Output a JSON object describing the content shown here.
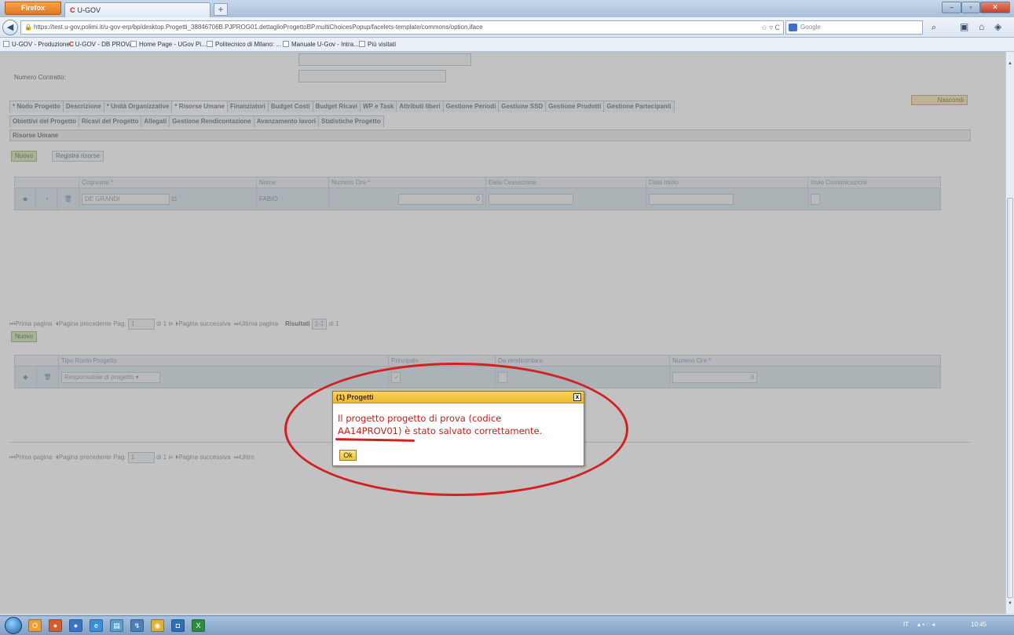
{
  "browser": {
    "menu_button": "Firefox",
    "tab_title": "U-GOV",
    "new_tab": "+",
    "url": "https://test.u-gov.polimi.it/u-gov-erp/bp/desktop.Progetti_38846706B.PJPROG01.dettaglioProgettoBP.multiChoicesPopup/facelets-template/commons/option.iface",
    "search_placeholder": "Google",
    "bookmarks": [
      "U-GOV - Produzione",
      "U-GOV - DB PROVA",
      "Home Page - UGov Pi...",
      "Politecnico di Milano: ...",
      "Manuale U-Gov - Intra...",
      "Più visitati"
    ]
  },
  "page": {
    "contract_label": "Numero Contratto:",
    "hide_button": "Nascondi",
    "tabs_row1": [
      {
        "label": "* Nodo Progetto",
        "active": false
      },
      {
        "label": "Descrizione",
        "active": false
      },
      {
        "label": "* Unità Organizzative",
        "active": false
      },
      {
        "label": "* Risorse Umane",
        "active": true
      },
      {
        "label": "Finanziatori",
        "active": false
      },
      {
        "label": "Budget Costi",
        "active": false
      },
      {
        "label": "Budget Ricavi",
        "active": false
      },
      {
        "label": "WP e Task",
        "active": false
      },
      {
        "label": "Attributi liberi",
        "active": false
      },
      {
        "label": "Gestione Periodi",
        "active": false
      },
      {
        "label": "Gestione SSD",
        "active": false
      },
      {
        "label": "Gestione Prodotti",
        "active": false
      },
      {
        "label": "Gestione Partecipanti",
        "active": false
      }
    ],
    "tabs_row2": [
      {
        "label": "Obiettivi del Progetto"
      },
      {
        "label": "Ricavi del Progetto"
      },
      {
        "label": "Allegati"
      },
      {
        "label": "Gestione Rendicontazione"
      },
      {
        "label": "Avanzamento lavori"
      },
      {
        "label": "Statistiche Progetto"
      }
    ],
    "section_title": "Risorse Umane",
    "new_button": "Nuovo",
    "register_button": "Registra risorse",
    "table1": {
      "headers": [
        "Cognome *",
        "Nome",
        "Numero Ore *",
        "Data Cessazione",
        "Data Inizio",
        "Invio Comunicazioni"
      ],
      "row": {
        "cognome": "DE GRANDI",
        "nome": "FABIO",
        "ore": "0"
      }
    },
    "pager1": {
      "first": "Prima pagina",
      "prev": "Pagina precedente",
      "page_label": "Pag.",
      "page_value": "1",
      "of": "di 1",
      "next": "Pagina successiva",
      "last": "Ultima pagina",
      "results_label": "Risultati",
      "results_value": "1-1",
      "results_of": "di 1"
    },
    "new_button2": "Nuovo",
    "table2": {
      "headers": [
        "Tipo Ruolo Progetto",
        "Principale",
        "Da rendicontare",
        "Numero Ore *"
      ],
      "row": {
        "ruolo": "Responsabile di progetto",
        "ore": "0"
      }
    },
    "pager2": {
      "first": "Prima pagina",
      "prev": "Pagina precedente",
      "page_label": "Pag.",
      "page_value": "1",
      "of": "di 1",
      "next": "Pagina successiva",
      "last": "Ultim"
    }
  },
  "dialog": {
    "title": "(1) Progetti",
    "close": "x",
    "message_line1": "Il progetto progetto di prova (codice",
    "message_code": "AA14PROV01)",
    "message_line2_rest": " è stato salvato correttamente.",
    "ok": "Ok"
  },
  "taskbar": {
    "lang": "IT",
    "time": "10:45"
  },
  "colors": {
    "dialog_header": "#f0b82b",
    "message_text": "#c4201b",
    "annotation": "#d42020"
  }
}
